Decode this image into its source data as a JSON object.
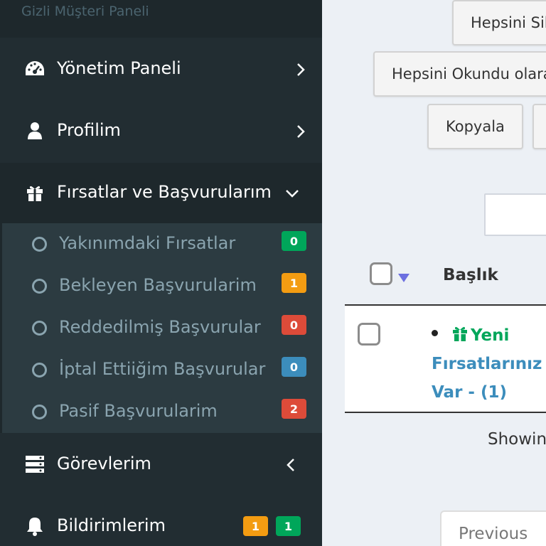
{
  "sidebar": {
    "brand": "Gizli Müşteri Paneli",
    "items": [
      {
        "label": "Yönetim Paneli",
        "icon": "dashboard-icon"
      },
      {
        "label": "Profilim",
        "icon": "user-icon"
      },
      {
        "label": "Fırsatlar ve Başvurularım",
        "icon": "gift-icon"
      },
      {
        "label": "Görevlerim",
        "icon": "server-icon"
      },
      {
        "label": "Bildirimlerim",
        "icon": "bell-icon"
      }
    ],
    "submenu": [
      {
        "label": "Yakınımdaki Fırsatlar",
        "badge": "0",
        "badge_color": "#00a65a"
      },
      {
        "label": "Bekleyen Başvurularim",
        "badge": "1",
        "badge_color": "#f39c12"
      },
      {
        "label": "Reddedilmiş Başvurular",
        "badge": "0",
        "badge_color": "#dd4b39"
      },
      {
        "label": "İptal Ettiiğim Başvurular",
        "badge": "0",
        "badge_color": "#3c8dbc"
      },
      {
        "label": "Pasif Başvurularim",
        "badge": "2",
        "badge_color": "#dd4b39"
      }
    ],
    "notification_badges": [
      {
        "value": "1",
        "color": "#f39c12"
      },
      {
        "value": "1",
        "color": "#00a65a"
      }
    ]
  },
  "main": {
    "buttons": {
      "delete_all": "Hepsini Sil",
      "mark_all_read": "Hepsini Okundu olarak",
      "copy": "Kopyala"
    },
    "table": {
      "header_title": "Başlık",
      "row_title_line1": "Yeni",
      "row_title_line2": "Fırsatlarınız",
      "row_title_line3": "Var - (1)"
    },
    "showing": "Showing",
    "previous": "Previous"
  },
  "colors": {
    "sidebar_bg": "#222d32",
    "accent_link": "#3c8dbc",
    "success": "#00a65a"
  }
}
